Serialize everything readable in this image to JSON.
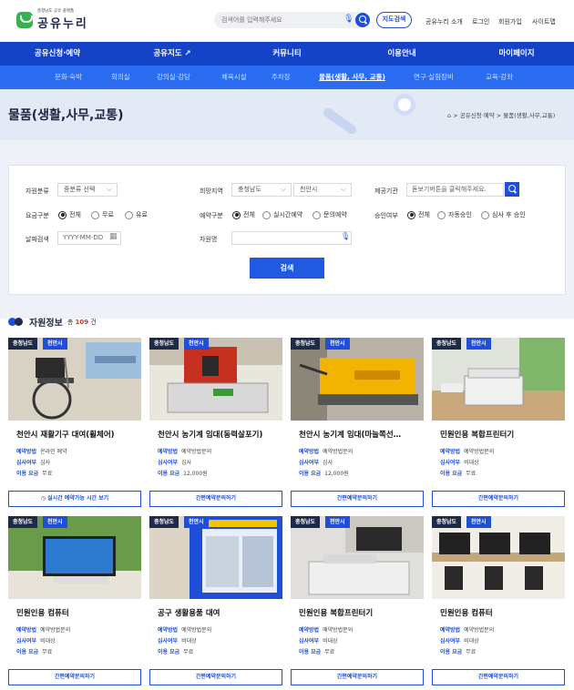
{
  "header": {
    "logo_sub": "충청남도 공유 플랫폼",
    "logo_main": "공유누리",
    "search_placeholder": "검색어를 입력해주세요",
    "map_search": "지도검색",
    "util_links": [
      "공유누리 소개",
      "로그인",
      "회원가입",
      "사이트맵"
    ]
  },
  "gnb": [
    "공유신청·예약",
    "공유지도 ↗",
    "커뮤니티",
    "이용안내",
    "마이페이지"
  ],
  "subnav": [
    "문화·숙박",
    "회의실",
    "강의실·강당",
    "체육시설",
    "주차장",
    "물품(생활, 사무, 교통)",
    "연구·실험장비",
    "교육·강좌"
  ],
  "banner": {
    "title": "물품(생활,사무,교통)",
    "breadcrumb": "> 공유신청·예약 > 물품(생활,사무,교통)"
  },
  "filter": {
    "resource_label": "자원분류",
    "resource_select": "중분류 선택",
    "region_label": "희망지역",
    "region_1": "충청남도",
    "region_2": "천안시",
    "provider_label": "제공기관",
    "provider_placeholder": "돋보기버튼을 클릭해주세요.",
    "fee_label": "요금구분",
    "fee_options": [
      "전체",
      "무료",
      "유료"
    ],
    "reserve_label": "예약구분",
    "reserve_options": [
      "전체",
      "실시간예약",
      "문의예약"
    ],
    "approve_label": "승인여부",
    "approve_options": [
      "전체",
      "자동승인",
      "심사 후 승인"
    ],
    "date_label": "날짜검색",
    "date_placeholder": "YYYY-MM-DD",
    "name_label": "자원명",
    "submit": "검색"
  },
  "results": {
    "title": "자원정보",
    "count_prefix": "총",
    "count": "109",
    "count_suffix": "건"
  },
  "cards": [
    {
      "tag1": "충청남도",
      "tag2": "천안시",
      "name": "천안시 재활기구 대여(휠체어)",
      "m1k": "예약방법",
      "m1v": "온라인 예약",
      "m2k": "심사여부",
      "m2v": "심사",
      "m3k": "이용 요금",
      "m3v": "무료",
      "btn": "실시간 예약가능 시간 보기"
    },
    {
      "tag1": "충청남도",
      "tag2": "천안시",
      "name": "천안시 농기계 임대(동력살포기)",
      "m1k": "예약방법",
      "m1v": "예약방법문의",
      "m2k": "심사여부",
      "m2v": "심사",
      "m3k": "이용 요금",
      "m3v": "12,000원",
      "btn": "간편예약문의하기"
    },
    {
      "tag1": "충청남도",
      "tag2": "천안시",
      "name": "천안시 농기계 임대(마늘쪽선…",
      "m1k": "예약방법",
      "m1v": "예약방법문의",
      "m2k": "심사여부",
      "m2v": "심사",
      "m3k": "이용 요금",
      "m3v": "12,000원",
      "btn": "간편예약문의하기"
    },
    {
      "tag1": "충청남도",
      "tag2": "천안시",
      "name": "민원인용 복합프린터기",
      "m1k": "예약방법",
      "m1v": "예약방법문의",
      "m2k": "심사여부",
      "m2v": "비대상",
      "m3k": "이용 요금",
      "m3v": "무료",
      "btn": "간편예약문의하기"
    },
    {
      "tag1": "충청남도",
      "tag2": "천안시",
      "name": "민원인용 컴퓨터",
      "m1k": "예약방법",
      "m1v": "예약방법문의",
      "m2k": "심사여부",
      "m2v": "비대상",
      "m3k": "이용 요금",
      "m3v": "무료",
      "btn": "간편예약문의하기"
    },
    {
      "tag1": "충청남도",
      "tag2": "천안시",
      "name": "공구 생활용품 대여",
      "m1k": "예약방법",
      "m1v": "예약방법문의",
      "m2k": "심사여부",
      "m2v": "비대상",
      "m3k": "이용 요금",
      "m3v": "무료",
      "btn": "간편예약문의하기"
    },
    {
      "tag1": "충청남도",
      "tag2": "천안시",
      "name": "민원인용 복합프린터기",
      "m1k": "예약방법",
      "m1v": "예약방법문의",
      "m2k": "심사여부",
      "m2v": "비대상",
      "m3k": "이용 요금",
      "m3v": "무료",
      "btn": "간편예약문의하기"
    },
    {
      "tag1": "충청남도",
      "tag2": "천안시",
      "name": "민원인용 컴퓨터",
      "m1k": "예약방법",
      "m1v": "예약방법문의",
      "m2k": "심사여부",
      "m2v": "비대상",
      "m3k": "이용 요금",
      "m3v": "무료",
      "btn": "간편예약문의하기"
    }
  ]
}
